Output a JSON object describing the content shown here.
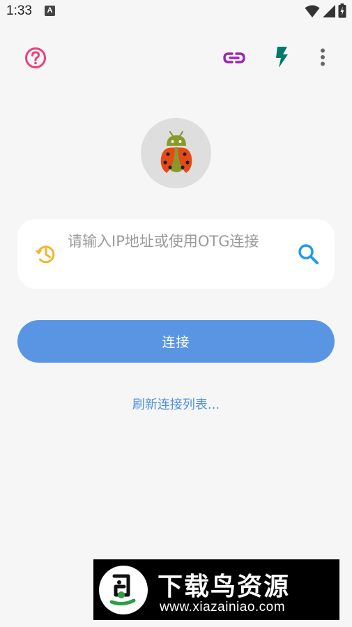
{
  "status_bar": {
    "time": "1:33",
    "notification_badge": "A",
    "icons": [
      "wifi-icon",
      "signal-icon",
      "battery-icon"
    ]
  },
  "toolbar": {
    "icons": [
      "help-circle-icon",
      "link-icon",
      "flash-icon",
      "more-vert-icon"
    ],
    "colors": {
      "help": "#ec407a",
      "link": "#9c27b0",
      "flash": "#00796b",
      "menu": "#666666"
    }
  },
  "logo": {
    "icon": "ladybug-android-icon"
  },
  "connect_form": {
    "placeholder": "请输入IP地址或使用OTG连接",
    "value": "",
    "history_icon": "history-icon",
    "search_icon": "search-icon",
    "connect_label": "连接",
    "refresh_label": "刷新连接列表...",
    "accent_color": "#5a95e3"
  },
  "watermark": {
    "title": "下载鸟资源",
    "url": "www.xiazainiao.com"
  }
}
